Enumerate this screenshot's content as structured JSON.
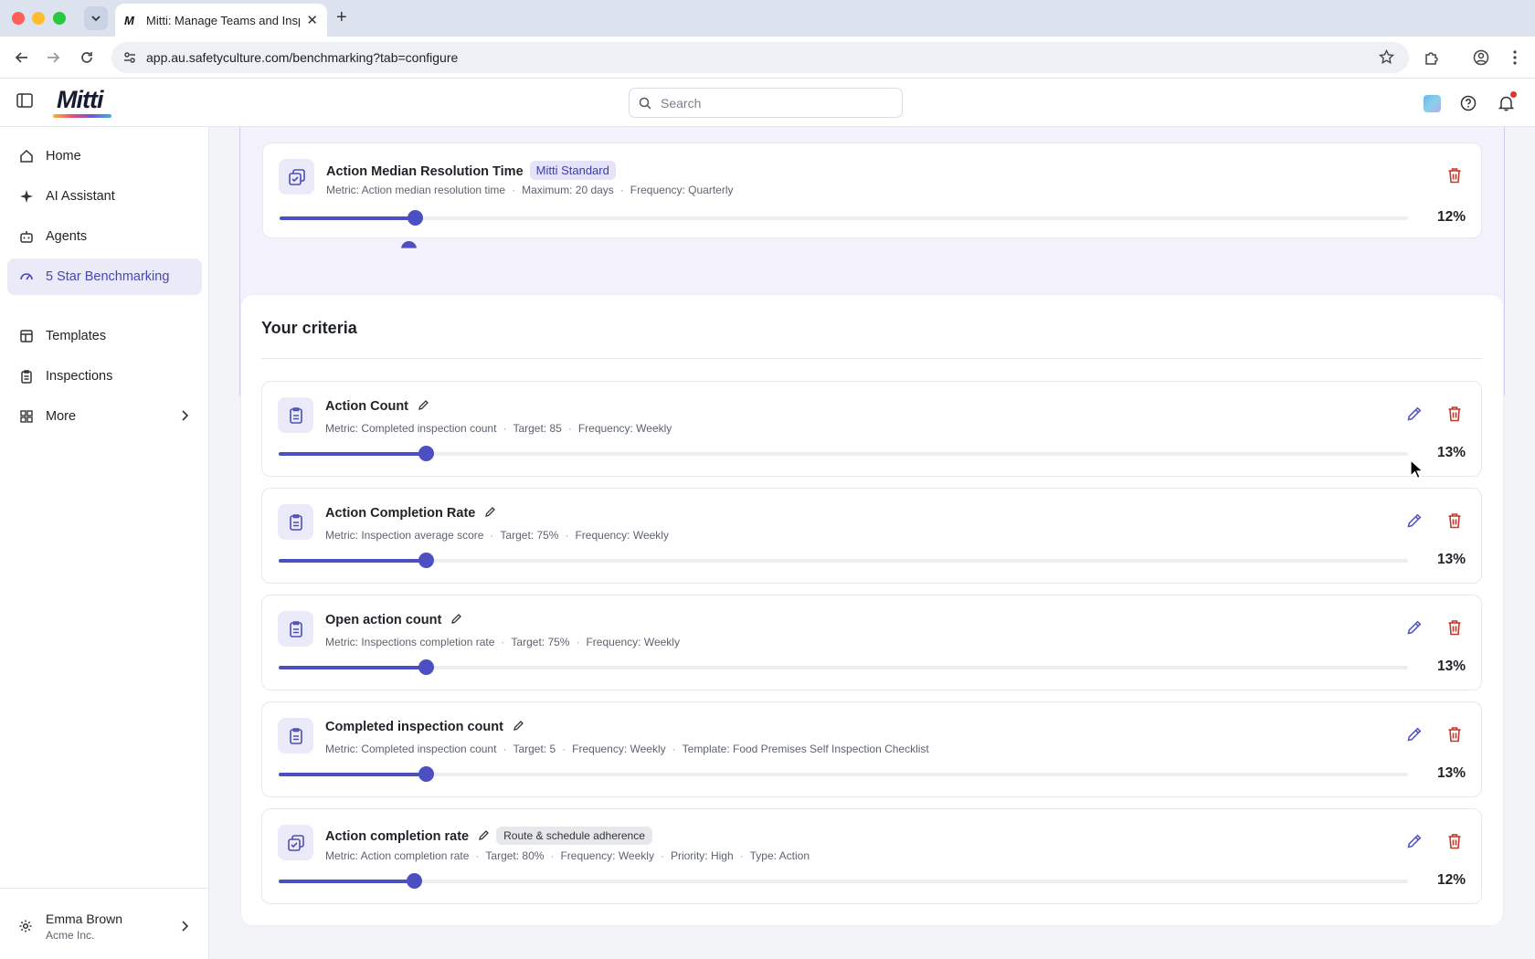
{
  "browser": {
    "tab_title": "Mitti: Manage Teams and Insp",
    "tab_favicon": "M",
    "url": "app.au.safetyculture.com/benchmarking?tab=configure"
  },
  "header": {
    "logo": "Mitti",
    "search_placeholder": "Search"
  },
  "sidebar": {
    "items": [
      {
        "label": "Home",
        "icon": "home-icon"
      },
      {
        "label": "AI Assistant",
        "icon": "sparkle-icon"
      },
      {
        "label": "Agents",
        "icon": "robot-icon"
      },
      {
        "label": "5 Star Benchmarking",
        "icon": "gauge-icon",
        "active": true
      },
      {
        "label": "Templates",
        "icon": "template-icon"
      },
      {
        "label": "Inspections",
        "icon": "clipboard-icon"
      },
      {
        "label": "More",
        "icon": "grid-icon"
      }
    ],
    "user": {
      "name": "Emma Brown",
      "org": "Acme Inc."
    }
  },
  "standard_card": {
    "title": "Action Median Resolution Time",
    "badge": "Mitti Standard",
    "meta": [
      "Metric: Action median resolution time",
      "Maximum: 20 days",
      "Frequency: Quarterly"
    ],
    "weight": 12,
    "weight_label": "12%"
  },
  "criteria": {
    "title": "Your criteria",
    "items": [
      {
        "title": "Action Count",
        "meta": [
          "Metric: Completed inspection count",
          "Target: 85",
          "Frequency: Weekly"
        ],
        "weight": 13,
        "weight_label": "13%",
        "icon": "clipboard-icon"
      },
      {
        "title": "Action Completion Rate",
        "meta": [
          "Metric: Inspection average score",
          "Target: 75%",
          "Frequency: Weekly"
        ],
        "weight": 13,
        "weight_label": "13%",
        "icon": "clipboard-icon"
      },
      {
        "title": "Open action count",
        "meta": [
          "Metric: Inspections completion rate",
          "Target: 75%",
          "Frequency: Weekly"
        ],
        "weight": 13,
        "weight_label": "13%",
        "icon": "clipboard-icon"
      },
      {
        "title": "Completed inspection count",
        "meta": [
          "Metric: Completed inspection count",
          "Target: 5",
          "Frequency: Weekly",
          "Template: Food Premises Self Inspection Checklist"
        ],
        "weight": 13,
        "weight_label": "13%",
        "icon": "clipboard-icon"
      },
      {
        "title": "Action completion rate",
        "tag": "Route & schedule adherence",
        "meta": [
          "Metric: Action completion rate",
          "Target: 80%",
          "Frequency: Weekly",
          "Priority: High",
          "Type: Action"
        ],
        "weight": 12,
        "weight_label": "12%",
        "icon": "action-icon"
      }
    ]
  },
  "colors": {
    "accent": "#4c4fc1",
    "delete": "#c0392b",
    "active_bg": "#ebeaf9"
  }
}
